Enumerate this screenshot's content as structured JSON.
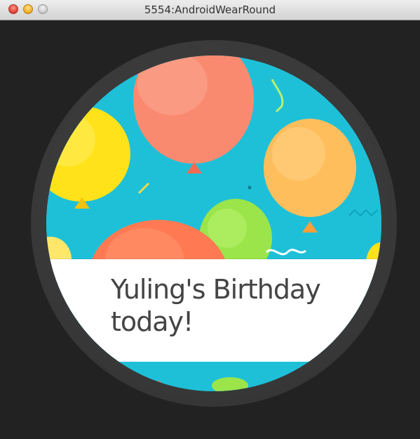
{
  "window": {
    "title": "5554:AndroidWearRound"
  },
  "notification": {
    "text": "Yuling's Birthday today!"
  },
  "colors": {
    "screen_background": "#1ec0d8",
    "balloon_salmon": "#f98a70",
    "balloon_yellow": "#ffe219",
    "balloon_orange": "#ffbe5c",
    "balloon_green": "#9be54a",
    "card_background": "#ffffff"
  },
  "icons": {
    "close": "close-button",
    "minimize": "minimize-button",
    "zoom": "zoom-button"
  }
}
